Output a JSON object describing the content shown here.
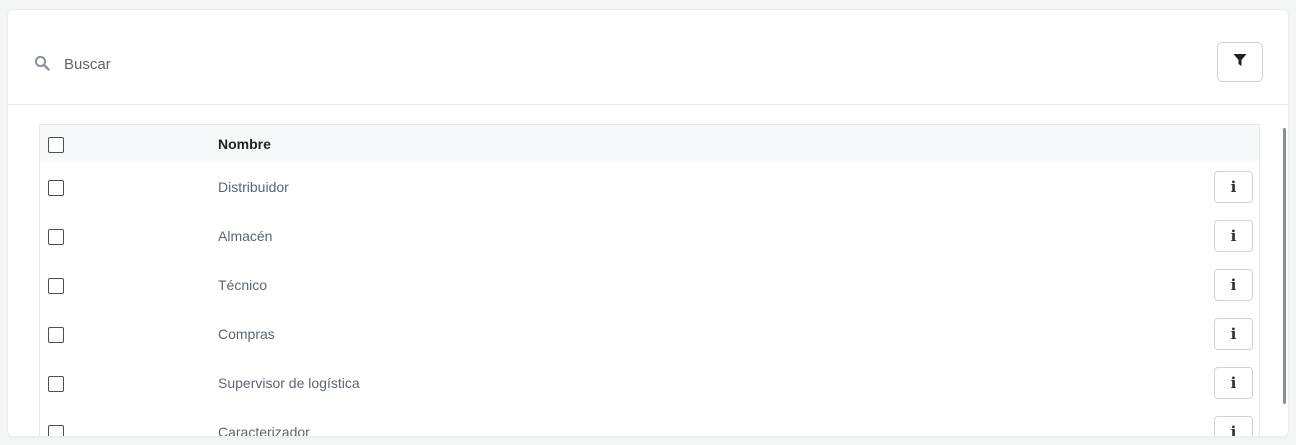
{
  "search": {
    "placeholder": "Buscar",
    "value": ""
  },
  "filter": {
    "icon": "filter-icon"
  },
  "table": {
    "header": {
      "name_label": "Nombre"
    },
    "rows": [
      {
        "label": "Distribuidor",
        "info": "i"
      },
      {
        "label": "Almacén",
        "info": "i"
      },
      {
        "label": "Técnico",
        "info": "i"
      },
      {
        "label": "Compras",
        "info": "i"
      },
      {
        "label": "Supervisor de logística",
        "info": "i"
      },
      {
        "label": "Caracterizador",
        "info": "i"
      }
    ]
  }
}
